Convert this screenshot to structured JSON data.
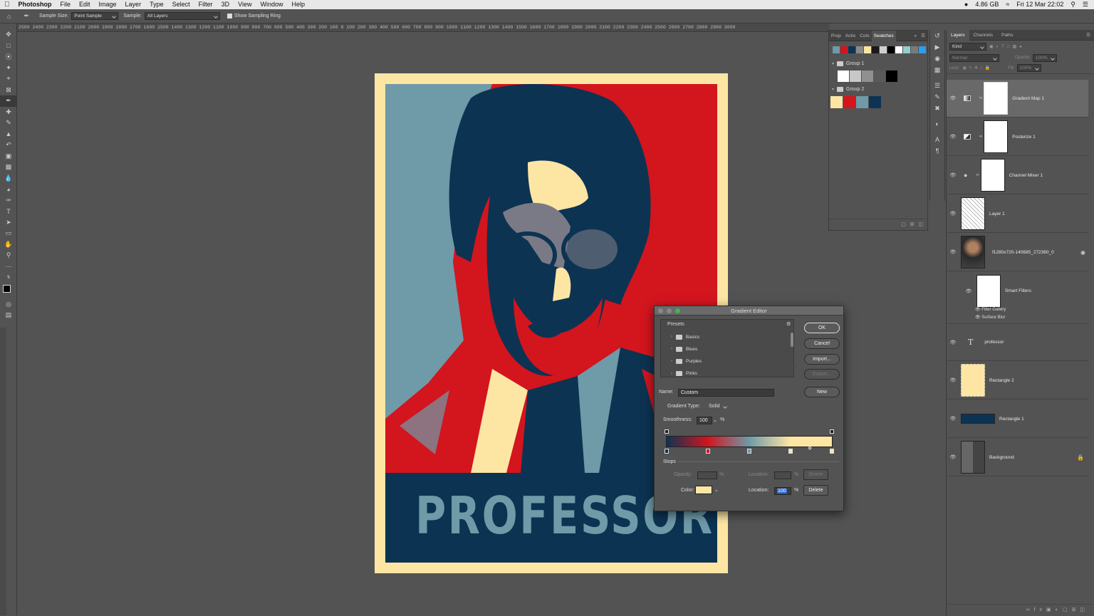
{
  "menubar": {
    "apple_icon": "apple-icon",
    "app_name": "Photoshop",
    "items": [
      "File",
      "Edit",
      "Image",
      "Layer",
      "Type",
      "Select",
      "Filter",
      "3D",
      "View",
      "Window",
      "Help"
    ],
    "memory": "4.86 GB",
    "datetime": "Fri 12 Mar  22:02"
  },
  "options": {
    "sample_size_label": "Sample Size:",
    "sample_size_value": "Point Sample",
    "sample_label": "Sample:",
    "sample_value": "All Layers",
    "show_ring_label": "Show Sampling Ring"
  },
  "ruler": {
    "ticks": "2500 2400 2300 2200 2100 2000 1900 1800 1700 1600 1500 1400 1300 1200 1100 1000  900   800   700   600   500   400   300   200   100    0     100   200   300   400   500   600   700   800   900  1000  1100  1200  1300  1400  1500  1600  1700  1800  1900  2000  2100  2200  2300  2400  2500  2600  2700  2800  2900  3000"
  },
  "poster": {
    "title": "PROFESSOR",
    "colors": {
      "cream": "#fde6a4",
      "red": "#d3151e",
      "navy": "#0d3352",
      "steel": "#6f9aa8"
    }
  },
  "swatches_panel": {
    "tabs": [
      "Prop",
      "Actio",
      "Colo",
      "Swatches"
    ],
    "top_swatches": [
      "#6f9aa8",
      "#d3151e",
      "#0d3352",
      "#8a8a8a",
      "#fde6a4",
      "#1a1a1a",
      "#cfcfcf",
      "#000000",
      "#ffffff",
      "#8fcfcf",
      "#7a7a7a",
      "#2a9df4"
    ],
    "groups": [
      {
        "name": "Group 1",
        "swatches": [
          "#ffffff",
          "#c8c8c8",
          "#909090",
          "#5a5a5a",
          "#000000"
        ]
      },
      {
        "name": "Group 2",
        "swatches": [
          "#fde6a4",
          "#d3151e",
          "#6f9aa8",
          "#0d3352"
        ]
      }
    ]
  },
  "layers_panel": {
    "tabs": [
      "Layers",
      "Channels",
      "Paths"
    ],
    "kind": "Kind",
    "blend": "Normal",
    "opacity_label": "Opacity:",
    "opacity_value": "100%",
    "lock_label": "Lock:",
    "fill_label": "Fill:",
    "fill_value": "100%",
    "layers": [
      {
        "name": "Gradient Map 1"
      },
      {
        "name": "Posterize 1"
      },
      {
        "name": "Channel Mixer 1"
      },
      {
        "name": "Layer 1"
      },
      {
        "name": "f1280x720-140685_272360_0"
      },
      {
        "name": "Smart Filters"
      },
      {
        "name": "professor"
      },
      {
        "name": "Rectangle 2"
      },
      {
        "name": "Rectangle 1"
      },
      {
        "name": "Background"
      }
    ],
    "filters": [
      "Filter Gallery",
      "Surface Blur"
    ],
    "text_layer_icon": "T"
  },
  "gradient_editor": {
    "title": "Gradient Editor",
    "presets_label": "Presets",
    "presets": [
      "Basics",
      "Blues",
      "Purples",
      "Pinks"
    ],
    "ok": "OK",
    "cancel": "Cancel",
    "import": "Import...",
    "export": "Export...",
    "name_label": "Name:",
    "name_value": "Custom",
    "new": "New",
    "gradient_type_label": "Gradient Type:",
    "gradient_type_value": "Solid",
    "smoothness_label": "Smoothness:",
    "smoothness_value": "100",
    "percent": "%",
    "stops_label": "Stops",
    "opacity_label": "Opacity:",
    "location_label": "Location:",
    "delete": "Delete",
    "color_label": "Color:",
    "location_value": "100",
    "color_value": "#fde6a4",
    "gradient_stops": [
      "#0d3352",
      "#d3151e",
      "#6f9aa8",
      "#fde6a4",
      "#fde6a4"
    ]
  }
}
